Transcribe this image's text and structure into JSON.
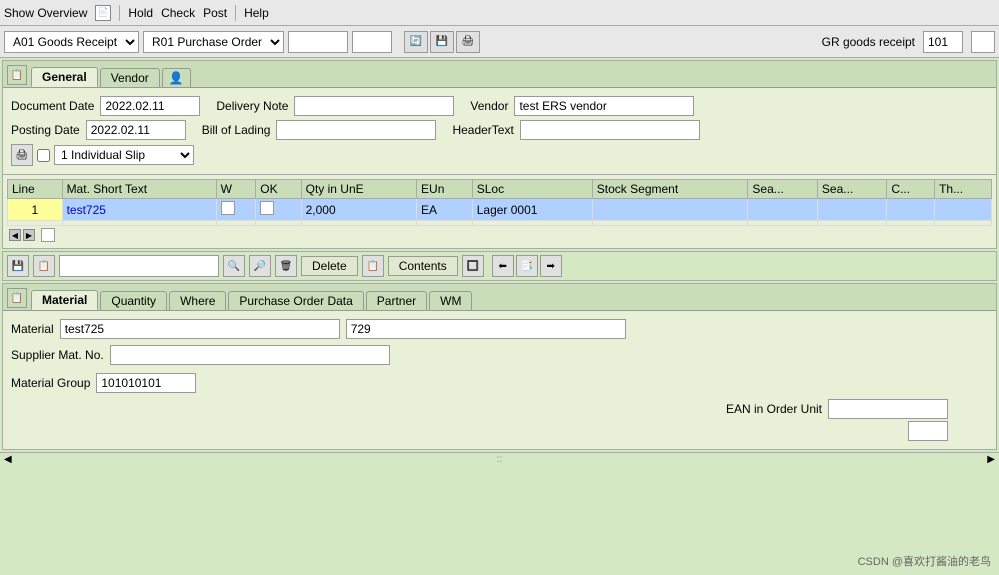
{
  "menubar": {
    "show_overview": "Show Overview",
    "hold": "Hold",
    "check": "Check",
    "post": "Post",
    "help": "Help"
  },
  "toolbar": {
    "movement_type": "A01 Goods Receipt",
    "order_type": "R01 Purchase Order",
    "gr_label": "GR goods receipt",
    "gr_value": "101"
  },
  "upper_tabs": {
    "general": "General",
    "vendor": "Vendor"
  },
  "general_tab": {
    "document_date_label": "Document Date",
    "document_date_value": "2022.02.11",
    "posting_date_label": "Posting Date",
    "posting_date_value": "2022.02.11",
    "delivery_note_label": "Delivery Note",
    "bill_of_lading_label": "Bill of Lading",
    "vendor_label": "Vendor",
    "vendor_value": "test ERS vendor",
    "headertext_label": "HeaderText",
    "slip_option": "1 Individual Slip"
  },
  "table": {
    "columns": [
      "Line",
      "Mat. Short Text",
      "W",
      "OK",
      "Qty in UnE",
      "EUn",
      "SLoc",
      "Stock Segment",
      "Sea...",
      "Sea...",
      "C...",
      "Th..."
    ],
    "rows": [
      {
        "line": "1",
        "mat_short_text": "test725",
        "w": "",
        "ok": "",
        "qty_in_une": "2,000",
        "eun": "EA",
        "sloc": "Lager 0001",
        "stock_segment": "",
        "sea1": "",
        "sea2": "",
        "c": "",
        "th": ""
      }
    ]
  },
  "table_toolbar": {
    "delete_label": "Delete",
    "contents_label": "Contents"
  },
  "lower_tabs": {
    "material": "Material",
    "quantity": "Quantity",
    "where": "Where",
    "purchase_order_data": "Purchase Order Data",
    "partner": "Partner",
    "wm": "WM"
  },
  "material_tab": {
    "material_label": "Material",
    "material_value": "test725",
    "material_num": "729",
    "supplier_mat_label": "Supplier Mat. No.",
    "supplier_mat_value": "",
    "material_group_label": "Material Group",
    "material_group_value": "101010101",
    "ean_label": "EAN in Order Unit",
    "ean_value": ""
  },
  "watermark": "CSDN @喜欢打酱油的老鸟"
}
